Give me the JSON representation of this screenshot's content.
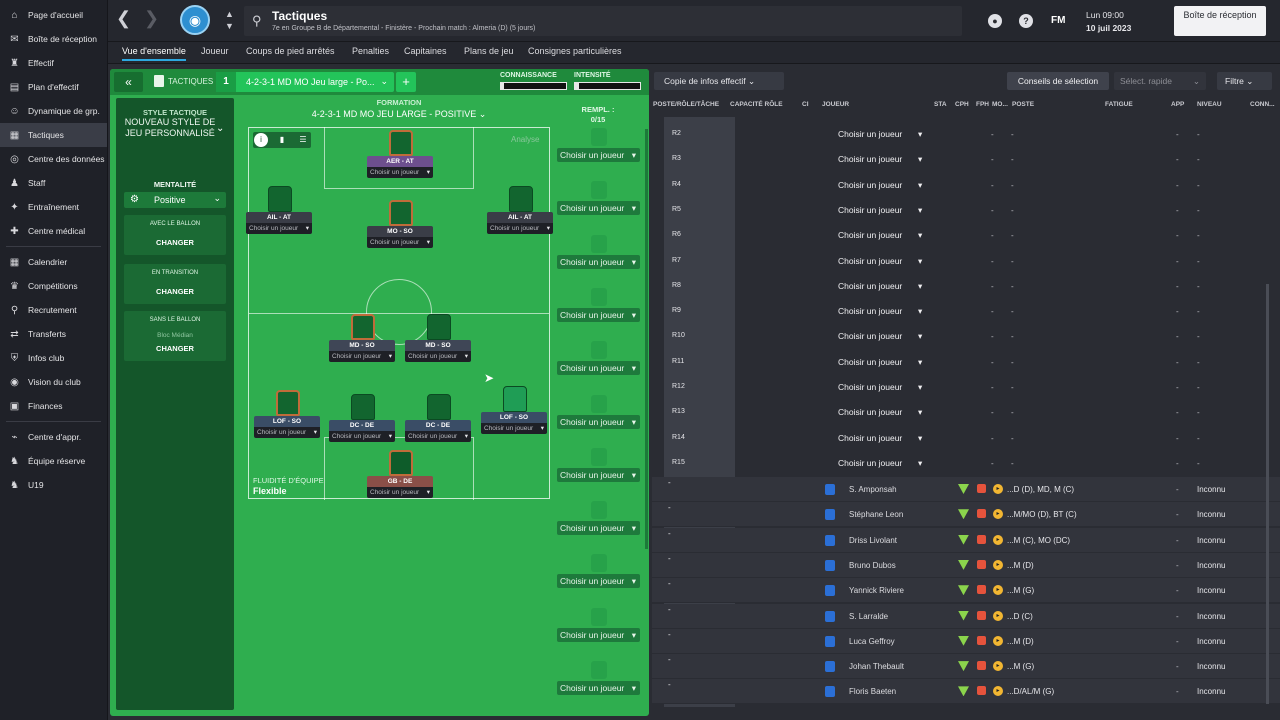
{
  "sidebar": {
    "items": [
      {
        "label": "Page d'accueil",
        "icon": "home-icon"
      },
      {
        "label": "Boîte de réception",
        "icon": "inbox-icon"
      },
      {
        "label": "Effectif",
        "icon": "shirt-icon"
      },
      {
        "label": "Plan d'effectif",
        "icon": "plan-icon"
      },
      {
        "label": "Dynamique de grp.",
        "icon": "group-icon"
      },
      {
        "label": "Tactiques",
        "icon": "tactics-icon",
        "active": true
      },
      {
        "label": "Centre des données",
        "icon": "data-icon"
      },
      {
        "label": "Staff",
        "icon": "staff-icon"
      },
      {
        "label": "Entraînement",
        "icon": "training-icon"
      },
      {
        "label": "Centre médical",
        "icon": "medical-icon"
      },
      {
        "label": "Calendrier",
        "icon": "calendar-icon"
      },
      {
        "label": "Compétitions",
        "icon": "trophy-icon"
      },
      {
        "label": "Recrutement",
        "icon": "scouting-icon"
      },
      {
        "label": "Transferts",
        "icon": "transfer-icon"
      },
      {
        "label": "Infos club",
        "icon": "shield-icon"
      },
      {
        "label": "Vision du club",
        "icon": "vision-icon"
      },
      {
        "label": "Finances",
        "icon": "finance-icon"
      },
      {
        "label": "Centre d'appr.",
        "icon": "academy-icon"
      },
      {
        "label": "Équipe réserve",
        "icon": "reserve-icon"
      },
      {
        "label": "U19",
        "icon": "youth-icon"
      }
    ]
  },
  "header": {
    "title": "Tactiques",
    "subtitle": "7e en Groupe B de Départemental - Finistère - Prochain match : Almeria (D) (5 jours)",
    "fm_label": "FM",
    "day": "Lun 09:00",
    "date": "10 juil 2023",
    "inbox_button": "Boîte de réception"
  },
  "tabs": [
    "Vue d'ensemble",
    "Joueur",
    "Coups de pied arrêtés",
    "Penalties",
    "Capitaines",
    "Plans de jeu",
    "Consignes particulières"
  ],
  "tactics": {
    "header_label": "TACTIQUES",
    "slot_number": "1",
    "formation_name": "4-2-3-1 MD MO Jeu large - Po...",
    "knowledge_label": "CONNAISSANCE",
    "knowledge_value": 0.05,
    "intensity_label": "INTENSITÉ",
    "intensity_value": 0.06,
    "style_label": "STYLE TACTIQUE",
    "style_value": "NOUVEAU STYLE DE JEU PERSONNALISÉ",
    "mentality_label": "MENTALITÉ",
    "mentality_value": "Positive",
    "phases": [
      {
        "label": "AVEC LE BALLON",
        "sub": "",
        "button": "CHANGER"
      },
      {
        "label": "EN TRANSITION",
        "sub": "",
        "button": "CHANGER"
      },
      {
        "label": "SANS LE BALLON",
        "sub": "Bloc Médian",
        "button": "CHANGER"
      }
    ],
    "formation_label": "FORMATION",
    "formation_full": "4-2-3-1 MD MO JEU LARGE - POSITIVE",
    "analyse_label": "Analyse",
    "fluidity_label": "FLUIDITÉ D'ÉQUIPE",
    "fluidity_value": "Flexible",
    "pick_label": "Choisir un joueur",
    "players": [
      {
        "role": "AER - AT",
        "type": "aer"
      },
      {
        "role": "AIL - AT",
        "type": "att"
      },
      {
        "role": "MO - SO",
        "type": "att"
      },
      {
        "role": "AIL - AT",
        "type": "att"
      },
      {
        "role": "MD - SO",
        "type": "mid"
      },
      {
        "role": "MD - SO",
        "type": "mid"
      },
      {
        "role": "LOF - SO",
        "type": "def"
      },
      {
        "role": "DC - DE",
        "type": "def"
      },
      {
        "role": "DC - DE",
        "type": "def"
      },
      {
        "role": "LOF - SO",
        "type": "def"
      },
      {
        "role": "GB - DE",
        "type": "gb"
      }
    ],
    "subs_label": "REMPL. :",
    "subs_count": "0/15",
    "sub_pick_label": "Choisir un joueur",
    "sub_slots": 11
  },
  "squad": {
    "copy_button": "Copie de infos effectif",
    "advice_button": "Conseils de sélection",
    "quick_select": "Sélect. rapide",
    "filter_button": "Filtre",
    "columns": [
      "POSTE/RÔLE/TÂCHE",
      "CAPACITÉ RÔLE",
      "CI",
      "JOUEUR",
      "STA",
      "CPH",
      "FPH",
      "MO...",
      "POSTE",
      "FATIGUE",
      "APP",
      "NIVEAU",
      "CONN..."
    ],
    "reserve_rows": [
      "R2",
      "R3",
      "R4",
      "R5",
      "R6",
      "R7",
      "R8",
      "R9",
      "R10",
      "R11",
      "R12",
      "R13",
      "R14",
      "R15"
    ],
    "reserve_pick": "Choisir un joueur",
    "dash": "-",
    "players": [
      {
        "name": "S. Amponsah",
        "pos": "...D (D), MD, M (C)",
        "app": "-",
        "level": "Inconnu"
      },
      {
        "name": "Stéphane Leon",
        "pos": "...M/MO (D), BT (C)",
        "app": "-",
        "level": "Inconnu"
      },
      {
        "name": "Driss Livolant",
        "pos": "...M (C), MO (DC)",
        "app": "-",
        "level": "Inconnu"
      },
      {
        "name": "Bruno Dubos",
        "pos": "...M (D)",
        "app": "-",
        "level": "Inconnu"
      },
      {
        "name": "Yannick Riviere",
        "pos": "...M (G)",
        "app": "-",
        "level": "Inconnu"
      },
      {
        "name": "S. Larralde",
        "pos": "...D (C)",
        "app": "-",
        "level": "Inconnu"
      },
      {
        "name": "Luca Geffroy",
        "pos": "...M (D)",
        "app": "-",
        "level": "Inconnu"
      },
      {
        "name": "Johan Thebault",
        "pos": "...M (G)",
        "app": "-",
        "level": "Inconnu"
      },
      {
        "name": "Floris Baeten",
        "pos": "...D/AL/M (G)",
        "app": "-",
        "level": "Inconnu"
      }
    ]
  }
}
